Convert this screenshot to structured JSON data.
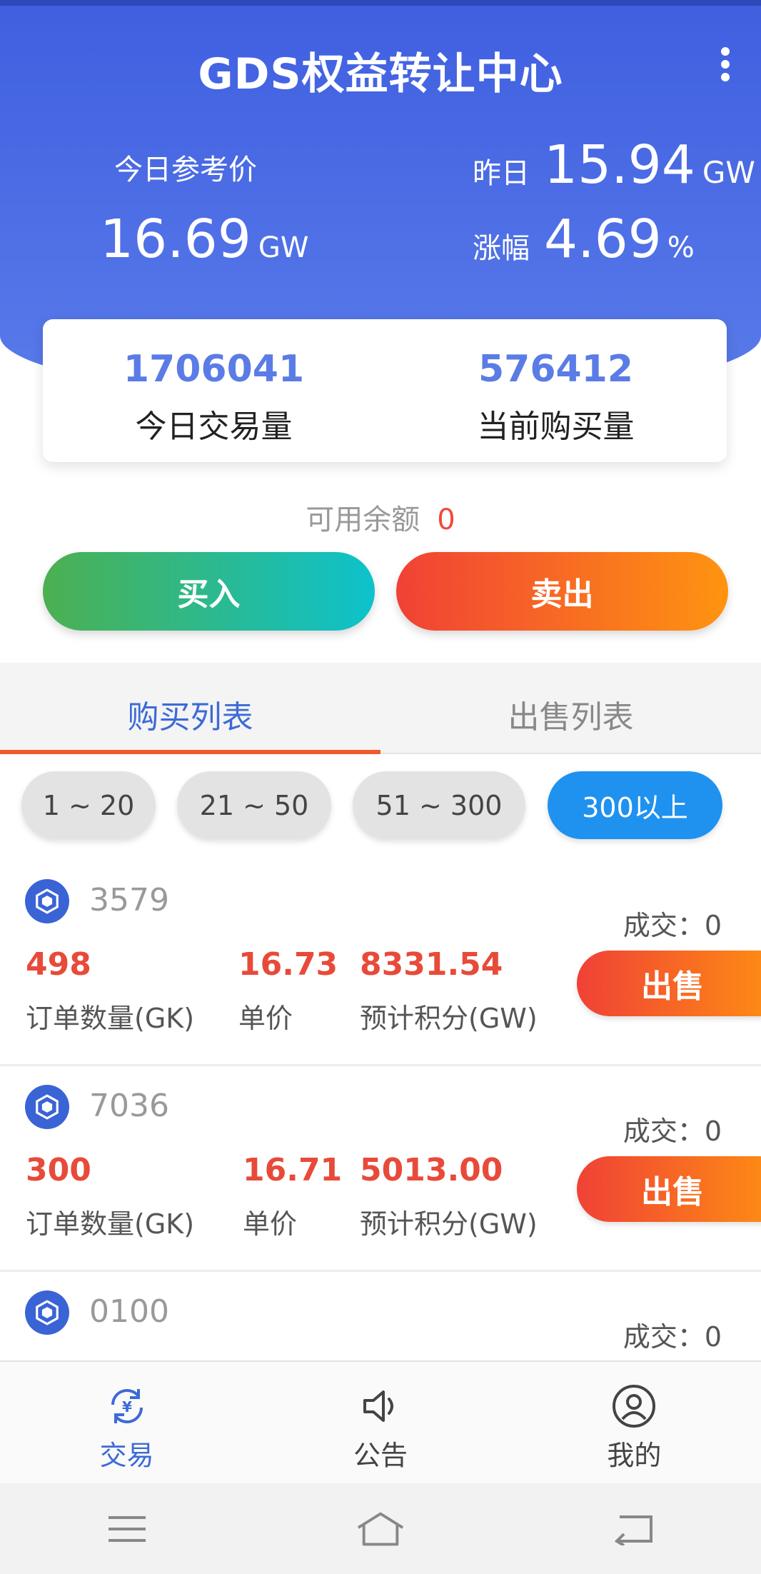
{
  "header": {
    "title": "GDS权益转让中心",
    "ref_price_label": "今日参考价",
    "ref_price_value": "16.69",
    "ref_price_unit": "GW",
    "yesterday_label": "昨日",
    "yesterday_value": "15.94",
    "yesterday_unit": "GW",
    "change_label": "涨幅",
    "change_value": "4.69",
    "change_unit": "%"
  },
  "stats": {
    "volume_value": "1706041",
    "volume_label": "今日交易量",
    "buy_amount_value": "576412",
    "buy_amount_label": "当前购买量"
  },
  "balance": {
    "label": "可用余额",
    "value": "0"
  },
  "actions": {
    "buy_label": "买入",
    "sell_label": "卖出"
  },
  "tabs": [
    {
      "label": "购买列表",
      "active": true
    },
    {
      "label": "出售列表",
      "active": false
    }
  ],
  "filters": [
    {
      "label": "1 ~ 20"
    },
    {
      "label": "21 ~ 50"
    },
    {
      "label": "51 ~ 300"
    },
    {
      "label": "300以上",
      "active": true
    }
  ],
  "orders": [
    {
      "id": "3579",
      "deal": "成交：0",
      "quantity": "498",
      "quantity_label": "订单数量(GK)",
      "price": "16.73",
      "price_label": "单价",
      "points": "8331.54",
      "points_label": "预计积分(GW)",
      "action_label": "出售"
    },
    {
      "id": "7036",
      "deal": "成交：0",
      "quantity": "300",
      "quantity_label": "订单数量(GK)",
      "price": "16.71",
      "price_label": "单价",
      "points": "5013.00",
      "points_label": "预计积分(GW)",
      "action_label": "出售"
    },
    {
      "id": "0100",
      "deal": "成交：0",
      "quantity": "",
      "quantity_label": "",
      "price": "",
      "price_label": "",
      "points": "",
      "points_label": "",
      "action_label": ""
    }
  ],
  "bottom_nav": [
    {
      "label": "交易",
      "icon": "yuan-exchange-icon",
      "active": true
    },
    {
      "label": "公告",
      "icon": "speaker-icon",
      "active": false
    },
    {
      "label": "我的",
      "icon": "user-icon",
      "active": false
    }
  ],
  "colors": {
    "primary": "#3f5fe0",
    "accent_blue": "#1f92f0",
    "red": "#e84a3a",
    "orange": "#ff9410",
    "green": "#4cb050",
    "cyan": "#0dc2cc"
  }
}
